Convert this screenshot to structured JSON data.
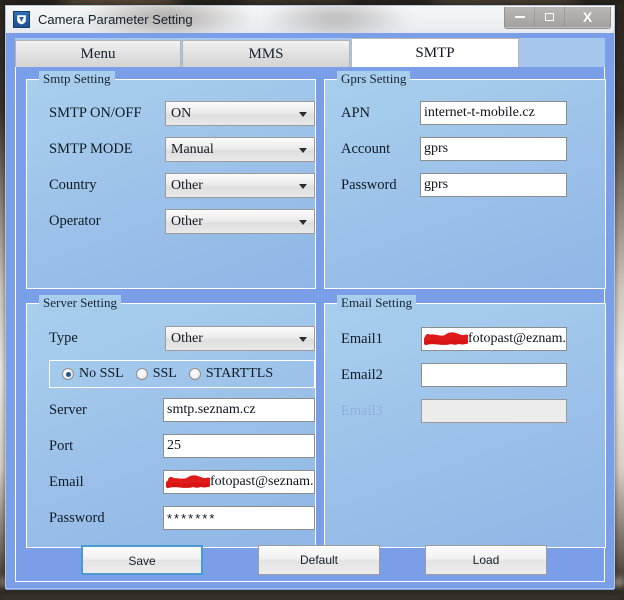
{
  "window": {
    "title": "Camera Parameter Setting",
    "icon": "app-shield-icon",
    "minimize_label": "Minimize",
    "maximize_label": "Maximize",
    "close_label": "X"
  },
  "tabs": [
    {
      "label": "Menu",
      "active": false
    },
    {
      "label": "MMS",
      "active": false
    },
    {
      "label": "SMTP",
      "active": true
    }
  ],
  "smtp_setting": {
    "title": "Smtp Setting",
    "fields": [
      {
        "label": "SMTP ON/OFF",
        "value": "ON"
      },
      {
        "label": "SMTP MODE",
        "value": "Manual"
      },
      {
        "label": "Country",
        "value": "Other"
      },
      {
        "label": "Operator",
        "value": "Other"
      }
    ]
  },
  "gprs_setting": {
    "title": "Gprs Setting",
    "fields": [
      {
        "label": "APN",
        "value": "internet-t-mobile.cz"
      },
      {
        "label": "Account",
        "value": "gprs"
      },
      {
        "label": "Password",
        "value": "gprs"
      }
    ]
  },
  "server_setting": {
    "title": "Server Setting",
    "type_label": "Type",
    "type_value": "Other",
    "ssl_options": [
      {
        "label": "No SSL",
        "checked": true
      },
      {
        "label": "SSL",
        "checked": false
      },
      {
        "label": "STARTTLS",
        "checked": false
      }
    ],
    "server_label": "Server",
    "server_value": "smtp.seznam.cz",
    "port_label": "Port",
    "port_value": "25",
    "email_label": "Email",
    "email_value": "fotopast@seznam.cz",
    "email_redacted": true,
    "password_label": "Password",
    "password_value": "*******"
  },
  "email_setting": {
    "title": "Email Setting",
    "rows": [
      {
        "label": "Email1",
        "value": "fotopast@eznam.cz",
        "redacted": true,
        "disabled": false
      },
      {
        "label": "Email2",
        "value": "",
        "redacted": false,
        "disabled": false
      },
      {
        "label": "Email3",
        "value": "",
        "redacted": false,
        "disabled": true
      }
    ]
  },
  "buttons": {
    "save": "Save",
    "default": "Default",
    "load": "Load"
  },
  "colors": {
    "client_blue": "#7b9ee8",
    "groupbox_blue": "#a9cfee",
    "accent_focus": "#4a9bd1",
    "redaction_red": "#e01b1b"
  }
}
